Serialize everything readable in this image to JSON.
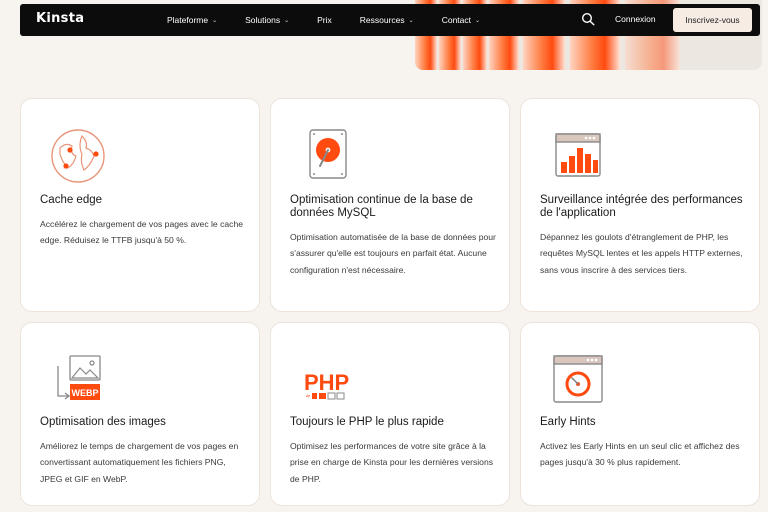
{
  "nav": {
    "logo": "Kinsta",
    "menu": [
      {
        "label": "Plateforme",
        "dropdown": true
      },
      {
        "label": "Solutions",
        "dropdown": true
      },
      {
        "label": "Prix",
        "dropdown": false
      },
      {
        "label": "Ressources",
        "dropdown": true
      },
      {
        "label": "Contact",
        "dropdown": true
      }
    ],
    "login": "Connexion",
    "signup": "Inscrivez-vous"
  },
  "colors": {
    "accent": "#ff4a10",
    "background": "#f7f3ef",
    "nav": "#0c0c0c"
  },
  "features": [
    {
      "icon": "globe-icon",
      "title": "Cache edge",
      "desc": "Accélérez le chargement de vos pages avec le cache edge. Réduisez le TTFB jusqu'à 50 %."
    },
    {
      "icon": "database-drive-icon",
      "title": "Optimisation continue de la base de données MySQL",
      "desc": "Optimisation automatisée de la base de données pour s'assurer qu'elle est toujours en parfait état. Aucune configuration n'est nécessaire."
    },
    {
      "icon": "performance-chart-icon",
      "title": "Surveillance intégrée des performances de l'application",
      "desc": "Dépannez les goulots d'étranglement de PHP, les requêtes MySQL lentes et les appels HTTP externes, sans vous inscrire à des services tiers."
    },
    {
      "icon": "webp-image-icon",
      "title": "Optimisation des images",
      "desc": "Améliorez le temps de chargement de vos pages en convertissant automatiquement les fichiers PNG, JPEG et GIF en WebP."
    },
    {
      "icon": "php-icon",
      "title": "Toujours le PHP le plus rapide",
      "desc": "Optimisez les performances de votre site grâce à la prise en charge de Kinsta pour les dernières versions de PHP."
    },
    {
      "icon": "gauge-window-icon",
      "title": "Early Hints",
      "desc": "Activez les Early Hints en un seul clic et affichez des pages jusqu'à 30 % plus rapidement."
    }
  ],
  "icon_text": {
    "webp": "WEBP",
    "php": "PHP"
  }
}
